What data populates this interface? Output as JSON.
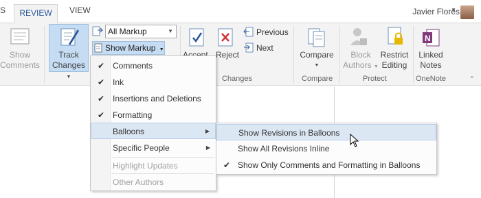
{
  "tabs": {
    "prev_partial": "S",
    "review": "REVIEW",
    "view": "VIEW"
  },
  "user": {
    "name": "Javier Flores"
  },
  "ribbon": {
    "show_comments": [
      "Show",
      "Comments"
    ],
    "track_changes": [
      "Track",
      "Changes"
    ],
    "markup_select": "All Markup",
    "show_markup": "Show Markup",
    "accept": "Accept",
    "reject": "Reject",
    "previous": "Previous",
    "next": "Next",
    "compare": "Compare",
    "block_authors": [
      "Block",
      "Authors"
    ],
    "restrict_editing": [
      "Restrict",
      "Editing"
    ],
    "linked_notes": [
      "Linked",
      "Notes"
    ],
    "groups": {
      "changes": "Changes",
      "compare": "Compare",
      "protect": "Protect",
      "onenote": "OneNote"
    }
  },
  "show_markup_menu": {
    "items": [
      {
        "label": "Comments",
        "checked": true
      },
      {
        "label": "Ink",
        "checked": true
      },
      {
        "label": "Insertions and Deletions",
        "checked": true
      },
      {
        "label": "Formatting",
        "checked": true
      },
      {
        "label": "Balloons",
        "submenu": true
      },
      {
        "label": "Specific People",
        "submenu": true
      },
      {
        "label": "Highlight Updates",
        "disabled": true
      },
      {
        "label": "Other Authors",
        "disabled": true
      }
    ]
  },
  "balloons_menu": {
    "items": [
      {
        "label": "Show Revisions in Balloons"
      },
      {
        "label": "Show All Revisions Inline"
      },
      {
        "label": "Show Only Comments and Formatting in Balloons",
        "checked": true
      }
    ]
  },
  "icons": {
    "help": "help-icon",
    "minimize": "minimize-ribbon-icon",
    "check": "checkmark-icon",
    "submenu": "submenu-arrow-icon"
  },
  "colors": {
    "accent": "#2b579a",
    "highlight": "#c5dcf3",
    "onenote": "#80397b"
  }
}
